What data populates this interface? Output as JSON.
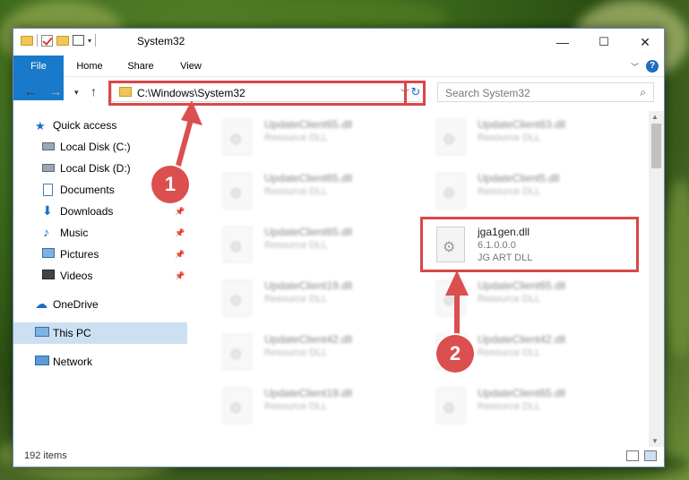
{
  "window": {
    "title": "System32",
    "minimize": "—",
    "maximize": "☐",
    "close": "✕"
  },
  "ribbon": {
    "tabs": [
      "File",
      "Home",
      "Share",
      "View"
    ]
  },
  "address": {
    "path": "C:\\Windows\\System32"
  },
  "search": {
    "placeholder": "Search System32"
  },
  "nav": {
    "items": [
      {
        "label": "Quick access",
        "icon": "star-icon"
      },
      {
        "label": "Local Disk (C:)",
        "icon": "drive-icon"
      },
      {
        "label": "Local Disk (D:)",
        "icon": "drive-icon"
      },
      {
        "label": "Documents",
        "icon": "documents-icon"
      },
      {
        "label": "Downloads",
        "icon": "download-icon"
      },
      {
        "label": "Music",
        "icon": "music-icon"
      },
      {
        "label": "Pictures",
        "icon": "pictures-icon"
      },
      {
        "label": "Videos",
        "icon": "videos-icon"
      },
      {
        "label": "OneDrive",
        "icon": "cloud-icon"
      },
      {
        "label": "This PC",
        "icon": "computer-icon"
      },
      {
        "label": "Network",
        "icon": "network-icon"
      }
    ]
  },
  "files": {
    "left": [
      {
        "name": "UpdateClient65.dll",
        "type": "Resource DLL"
      },
      {
        "name": "UpdateClient65.dll",
        "type": "Resource DLL"
      },
      {
        "name": "UpdateClient65.dll",
        "type": "Resource DLL"
      },
      {
        "name": "UpdateClient19.dll",
        "type": "Resource DLL"
      },
      {
        "name": "UpdateClient42.dll",
        "type": "Resource DLL"
      },
      {
        "name": "UpdateClient19.dll",
        "type": "Resource DLL"
      }
    ],
    "right": [
      {
        "name": "UpdateClient63.dll",
        "type": "Resource DLL"
      },
      {
        "name": "UpdateClient5.dll",
        "type": "Resource DLL"
      },
      {
        "name": "UpdateClient65.dll",
        "type": "Resource DLL"
      },
      {
        "name": "UpdateClient42.dll",
        "type": "Resource DLL"
      },
      {
        "name": "UpdateClient65.dll",
        "type": "Resource DLL"
      }
    ],
    "highlighted": {
      "name": "jga1gen.dll",
      "version": "6.1.0.0.0",
      "type": "JG ART DLL"
    }
  },
  "status": {
    "count": "192 items"
  },
  "badges": {
    "one": "1",
    "two": "2"
  },
  "colors": {
    "accent": "#1979ca",
    "highlight": "#d9474a"
  }
}
